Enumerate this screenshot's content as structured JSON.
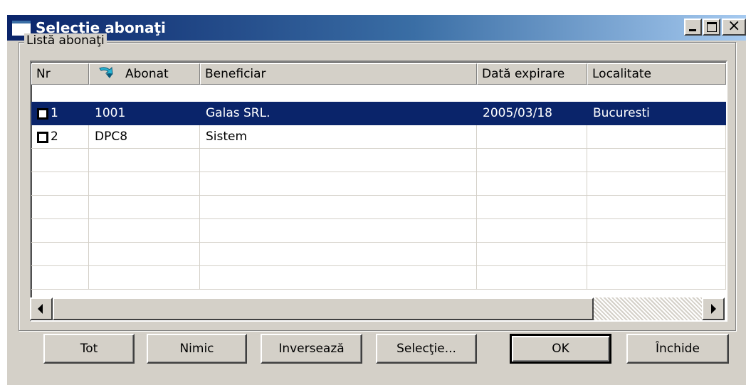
{
  "window": {
    "title": "Selecţie abonaţi"
  },
  "group": {
    "label": "Listă abonaţi"
  },
  "grid": {
    "columns": [
      "Nr",
      "Abonat",
      "Beneficiar",
      "Dată expirare",
      "Localitate"
    ],
    "sort_column": "Abonat",
    "sort_icon": "sort-arrow-icon",
    "rows": [
      {
        "nr": "1",
        "abonat": "1001",
        "beneficiar": "Galas SRL.",
        "data_expirare": "2005/03/18",
        "localitate": "Bucuresti",
        "selected": true,
        "checked": false
      },
      {
        "nr": "2",
        "abonat": "DPC8",
        "beneficiar": "Sistem",
        "data_expirare": "",
        "localitate": "",
        "selected": false,
        "checked": false
      }
    ],
    "empty_rows": 6
  },
  "buttons": {
    "tot": "Tot",
    "nimic": "Nimic",
    "inverseaza": "Inversează",
    "selectie": "Selecţie...",
    "ok": "OK",
    "inchide": "Închide"
  },
  "colors": {
    "title_gradient_start": "#0a246a",
    "title_gradient_end": "#a6caf0",
    "selection": "#0a246a",
    "face": "#d4d0c8"
  }
}
